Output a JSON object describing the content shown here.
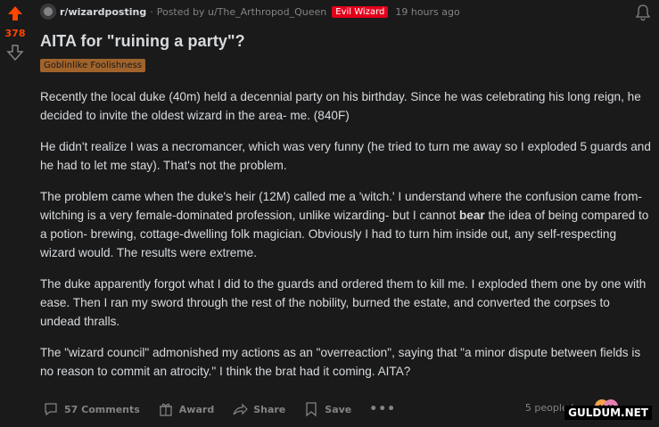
{
  "post": {
    "score": "378",
    "subreddit": "r/wizardposting",
    "posted_by": "Posted by u/The_Arthropod_Queen",
    "user_flair": "Evil Wizard",
    "time": "19 hours ago",
    "title": "AITA for \"ruining a party\"?",
    "post_flair": "Goblinlike Foolishness",
    "paragraphs": {
      "p1": "Recently the local duke (40m) held a decennial party on his birthday. Since he was celebrating his long reign, he decided to invite the oldest wizard in the area- me. (840F)",
      "p2": "He didn't realize I was a necromancer, which was very funny (he tried to turn me away so I exploded 5 guards and he had to let me stay). That's not the problem.",
      "p3a": "The problem came when the duke's heir (12M) called me a 'witch.' I understand where the confusion came from- witching is a very female-dominated profession, unlike wizarding- but I cannot ",
      "p3b": "bear",
      "p3c": " the idea of being compared to a potion- brewing, cottage-dwelling folk magician. Obviously I had to turn him inside out, any self-respecting wizard would. The results were extreme.",
      "p4": "The duke apparently forgot what I did to the guards and ordered them to kill me. I exploded them one by one with ease. Then I ran my sword through the rest of the nobility, burned the estate, and converted the corpses to undead thralls.",
      "p5": "The \"wizard council\" admonished my actions as an \"overreaction\", saying that \"a minor dispute between fields is no reason to commit an atrocity.\" I think the brat had it coming. AITA?"
    }
  },
  "actions": {
    "comments": "57 Comments",
    "award": "Award",
    "share": "Share",
    "save": "Save",
    "more": "•••"
  },
  "presence": "5 people here",
  "watermark": "GULDUM.NET",
  "colors": {
    "upvote": "#ff4500",
    "user_flair_bg": "#e4001b",
    "post_flair_bg": "#a0632b",
    "background": "#1a1a1b"
  },
  "icons": [
    "upvote-icon",
    "downvote-icon",
    "subreddit-avatar",
    "bell-icon",
    "comment-icon",
    "award-icon",
    "share-icon",
    "save-icon",
    "more-icon"
  ]
}
